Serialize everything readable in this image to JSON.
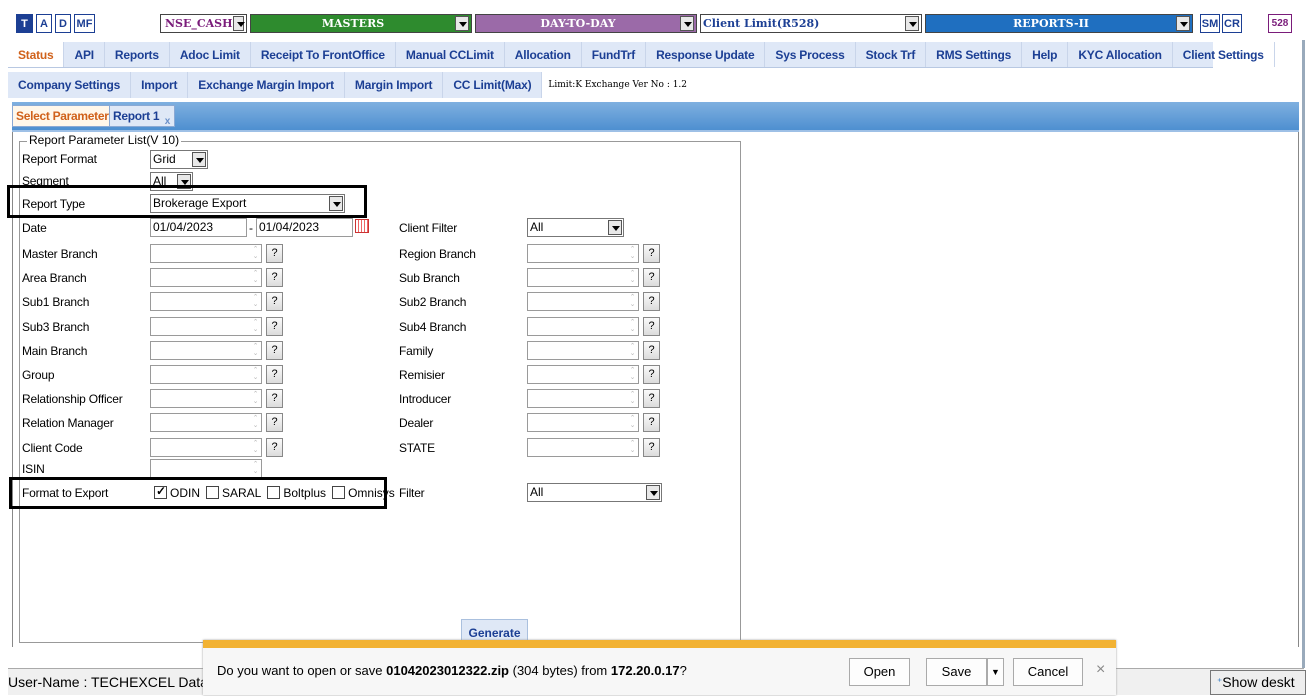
{
  "topbar": {
    "t": "T",
    "a": "A",
    "d": "D",
    "mf": "MF",
    "exchange": "NSE_CASH",
    "masters": "MASTERS",
    "daytoday": "DAY-TO-DAY",
    "client_limit": "Client Limit(R528)",
    "reports2": "REPORTS-II",
    "sm": "SM",
    "cr": "CR",
    "id": "528",
    "colors": {
      "masters": "#2e8b2e",
      "daytoday": "#9b6aa8",
      "reports2": "#1f6fc0",
      "accent": "#1c3f94"
    }
  },
  "menu1": [
    "Status",
    "API",
    "Reports",
    "Adoc Limit",
    "Receipt To FrontOffice",
    "Manual CCLimit",
    "Allocation",
    "FundTrf",
    "Response Update",
    "Sys Process",
    "Stock Trf",
    "RMS Settings",
    "Help",
    "KYC Allocation",
    "Client Settings"
  ],
  "menu2": [
    "Company Settings",
    "Import",
    "Exchange Margin Import",
    "Margin Import",
    "CC Limit(Max)"
  ],
  "limit_info": "Limit:K Exchange Ver No : 1.2",
  "tabs": {
    "select_parameter": "Select Parameter",
    "report1": "Report 1",
    "close": "x"
  },
  "params": {
    "legend": "Report Parameter List(V 10)",
    "report_format_label": "Report Format",
    "report_format": "Grid",
    "segment_label": "Segment",
    "segment": "All",
    "report_type_label": "Report Type",
    "report_type": "Brokerage Export",
    "date_label": "Date",
    "date_from": "01/04/2023",
    "date_sep": "-",
    "date_to": "01/04/2023",
    "client_filter_label": "Client Filter",
    "client_filter": "All",
    "left_fields": [
      "Master Branch",
      "Area Branch",
      "Sub1 Branch",
      "Sub3 Branch",
      "Main Branch",
      "Group",
      "Relationship Officer",
      "Relation Manager",
      "Client Code"
    ],
    "right_fields": [
      "Region Branch",
      "Sub Branch",
      "Sub2 Branch",
      "Sub4 Branch",
      "Family",
      "Remisier",
      "Introducer",
      "Dealer",
      "STATE"
    ],
    "isin_label": "ISIN",
    "q": "?",
    "export_label": "Format to Export",
    "export_options": [
      "ODIN",
      "SARAL",
      "Boltplus",
      "Omnisys"
    ],
    "filter_label": "Filter",
    "filter": "All"
  },
  "generate": "Generate",
  "status": "User-Name : TECHEXCEL Data:C",
  "download": {
    "prefix": "Do you want to open or save ",
    "file": "01042023012322.zip",
    "mid": " (304 bytes) from ",
    "host": "172.20.0.17",
    "suffix": "?",
    "open": "Open",
    "save": "Save",
    "cancel": "Cancel",
    "close": "×"
  },
  "show_desktop": "Show deskt"
}
